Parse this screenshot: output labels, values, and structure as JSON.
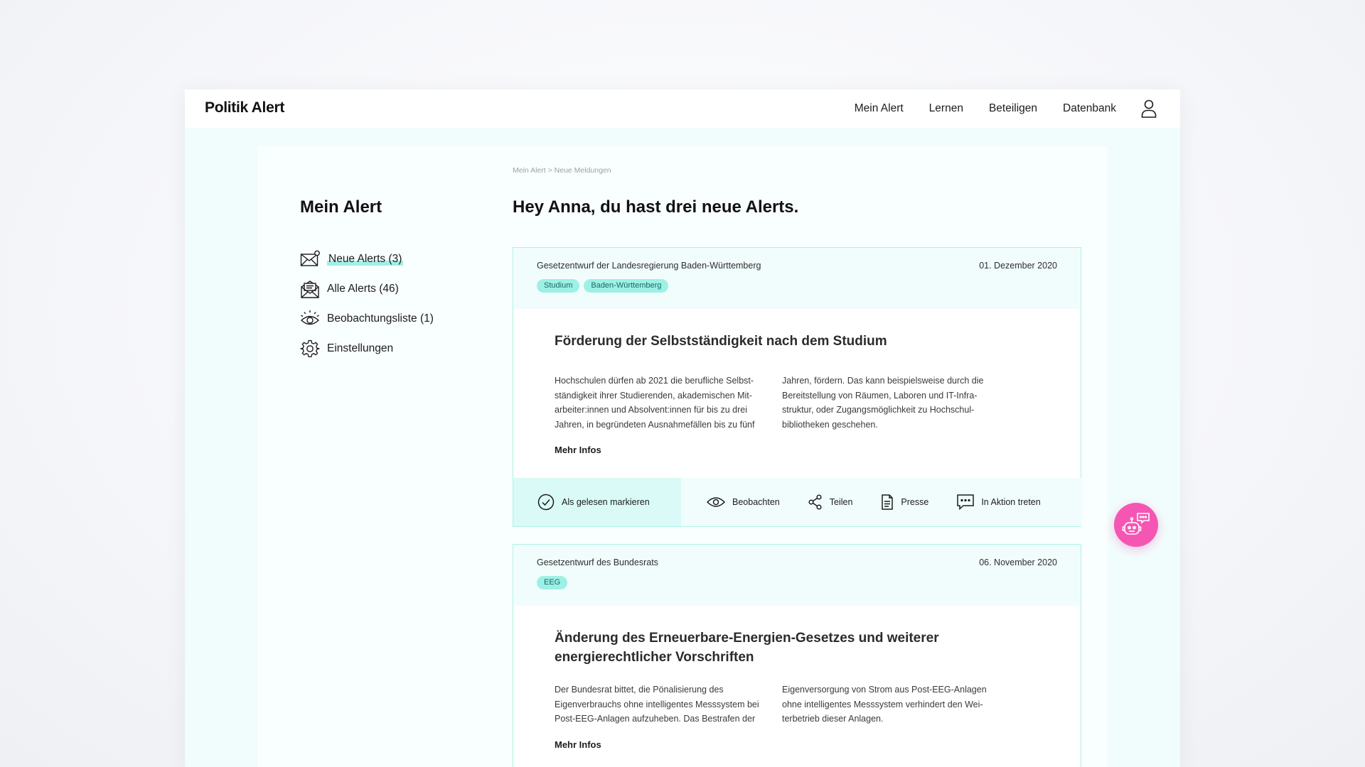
{
  "brand": "Politik Alert",
  "nav": {
    "items": [
      {
        "label": "Mein Alert",
        "active": true
      },
      {
        "label": "Lernen"
      },
      {
        "label": "Beteiligen"
      },
      {
        "label": "Datenbank"
      }
    ],
    "user_icon": "user-icon"
  },
  "sidebar": {
    "title": "Mein Alert",
    "items": [
      {
        "label": "Neue Alerts (3)",
        "icon": "envelope-icon",
        "active": true
      },
      {
        "label": "Alle Alerts (46)",
        "icon": "mail-open-icon"
      },
      {
        "label": "Beobachtungsliste (1)",
        "icon": "eye-icon"
      },
      {
        "label": "Einstellungen",
        "icon": "gear-icon"
      }
    ]
  },
  "breadcrumb": "Mein Alert > Neue Meldungen",
  "page_title": "Hey Anna, du hast drei neue Alerts.",
  "alerts": [
    {
      "source": "Gesetzentwurf der Landesregierung Baden-Württemberg",
      "date": "01. Dezember 2020",
      "tags": [
        "Studium",
        "Baden-Württemberg"
      ],
      "title": "Förderung der Selbstständigkeit nach dem Studium",
      "col1": "Hochschulen dürfen ab 2021 die berufliche Selbst-ständigkeit ihrer Studierenden, akademischen Mit-arbeiter:innen und Absolvent:innen für bis zu drei Jahren, in begründeten Ausnahmefällen bis zu fünf",
      "col2": "Jahren, fördern. Das kann beispielsweise durch die Bereitstellung von Räumen, Laboren und IT-Infra-struktur, oder Zugangsmöglichkeit zu Hochschul-bibliotheken geschehen.",
      "more": "Mehr Infos"
    },
    {
      "source": "Gesetzentwurf des Bundesrats",
      "date": "06. November 2020",
      "tags": [
        "EEG"
      ],
      "title": "Änderung des Erneuerbare-Energien-Gesetzes und weiterer energierechtlicher Vorschriften",
      "col1": "Der Bundesrat bittet, die Pönalisierung des Eigenverbrauchs ohne intelligentes Messsystem bei Post-EEG-Anlagen aufzuheben. Das Bestrafen der",
      "col2": "Eigenversorgung von Strom aus Post-EEG-Anlagen ohne intelligentes Messsystem verhindert den Wei-terbetrieb dieser Anlagen.",
      "more": "Mehr Infos"
    }
  ],
  "actions": {
    "mark_read": "Als gelesen markieren",
    "watch": "Beobachten",
    "share": "Teilen",
    "press": "Presse",
    "act": "In Aktion treten"
  },
  "colors": {
    "accent": "#9df0e5",
    "panel_bg": "#f1fdfc",
    "bot": "#f556b4"
  }
}
